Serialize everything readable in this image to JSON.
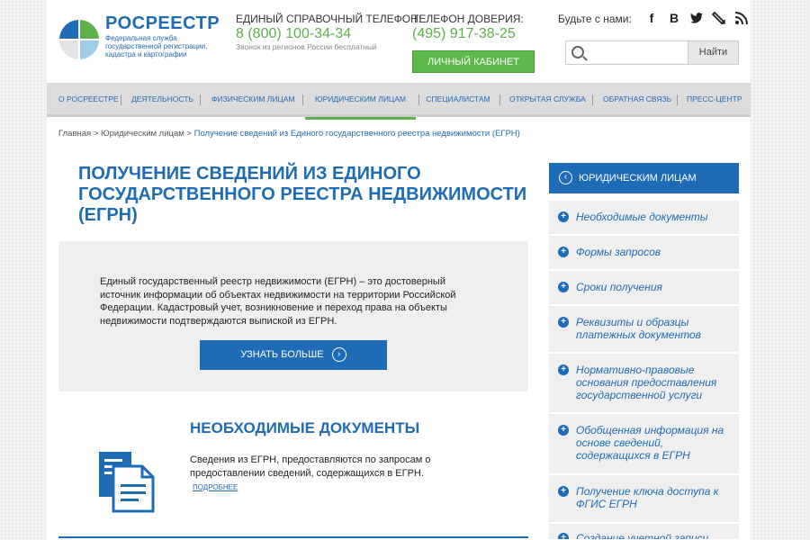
{
  "header": {
    "logo_title": "РОСРЕЕСТР",
    "logo_subtitle": "Федеральная служба государственной регистрации, кадастра и картографии",
    "phone1_label": "ЕДИНЫЙ СПРАВОЧНЫЙ ТЕЛЕФОН:",
    "phone1_number": "8 (800) 100-34-34",
    "phone1_note": "Звонок из регионов России бесплатный",
    "phone2_label": "ТЕЛЕФОН ДОВЕРИЯ:",
    "phone2_number": "(495) 917-38-25",
    "cabinet_label": "ЛИЧНЫЙ КАБИНЕТ",
    "social_label": "Будьте с нами:",
    "social_icons": [
      "facebook-icon",
      "vk-icon",
      "twitter-icon",
      "livejournal-icon",
      "rss-icon"
    ],
    "search_placeholder": "",
    "search_button": "Найти"
  },
  "nav": {
    "items": [
      {
        "label": "О РОСРЕЕСТРЕ"
      },
      {
        "label": "ДЕЯТЕЛЬНОСТЬ"
      },
      {
        "label": "ФИЗИЧЕСКИМ ЛИЦАМ"
      },
      {
        "label": "ЮРИДИЧЕСКИМ ЛИЦАМ"
      },
      {
        "label": "СПЕЦИАЛИСТАМ"
      },
      {
        "label": "ОТКРЫТАЯ СЛУЖБА"
      },
      {
        "label": "ОБРАТНАЯ СВЯЗЬ"
      },
      {
        "label": "ПРЕСС-ЦЕНТР"
      }
    ],
    "active_index": 3
  },
  "breadcrumb": {
    "items": [
      "Главная",
      "Юридическим лицам",
      "Получение сведений из Единого государственного реестра недвижимости (ЕГРН)"
    ],
    "separator": ">"
  },
  "main": {
    "title": "ПОЛУЧЕНИЕ СВЕДЕНИЙ ИЗ ЕДИНОГО ГОСУДАРСТВЕННОГО РЕЕСТРА НЕДВИЖИМОСТИ (ЕГРН)",
    "intro_text": "Единый государственный реестр недвижимости (ЕГРН) – это достоверный источник информации об объектах недвижимости на территории Российской Федерации. Кадастровый учет, возникновение и переход права на объекты недвижимости подтверждаются выпиской из ЕГРН.",
    "more_button": "УЗНАТЬ БОЛЬШЕ",
    "docs_title": "НЕОБХОДИМЫЕ ДОКУМЕНТЫ",
    "docs_text": "Сведения из ЕГРН, предоставляются по запросам о предоставлении сведений, содержащихся в ЕГРН.",
    "docs_link": "ПОДРОБНЕЕ"
  },
  "sidebar": {
    "header": "ЮРИДИЧЕСКИМ ЛИЦАМ",
    "items": [
      {
        "label": "Необходимые документы"
      },
      {
        "label": "Формы запросов"
      },
      {
        "label": "Сроки получения"
      },
      {
        "label": "Реквизиты и образцы платежных документов"
      },
      {
        "label": "Нормативно-правовые основания предоставления государственной услуги"
      },
      {
        "label": "Обобщенная информация на основе сведений, содержащихся в ЕГРН"
      },
      {
        "label": "Получение ключа доступа к ФГИС ЕГРН"
      },
      {
        "label": "Создание учетной записи"
      }
    ]
  },
  "colors": {
    "brand_blue": "#1f6bb5",
    "brand_green": "#5db04a"
  }
}
